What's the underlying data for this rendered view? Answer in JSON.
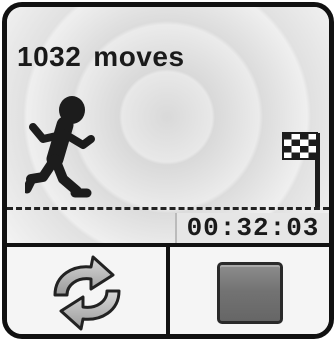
{
  "status": {
    "moves_count": "1032",
    "moves_label": "moves"
  },
  "timer": {
    "elapsed": "00:32:03"
  },
  "icons": {
    "runner": "running-person-icon",
    "finish": "checkered-flag-icon",
    "restart": "refresh-arrows-icon",
    "stop": "stop-square-icon"
  },
  "colors": {
    "frame": "#111111",
    "screen": "#ececec",
    "ink": "#1a1a1a",
    "stop_fill": "#777777"
  }
}
